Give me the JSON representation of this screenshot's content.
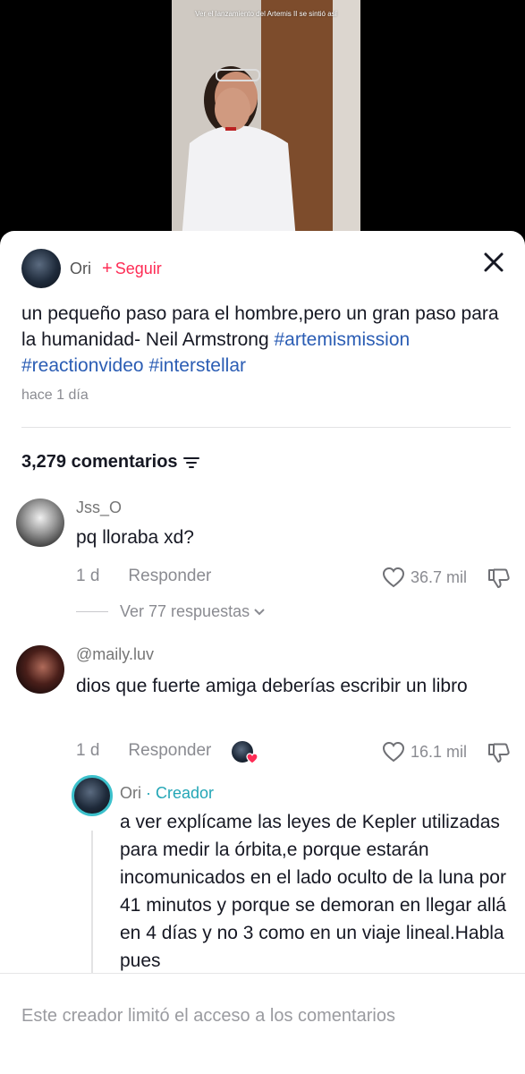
{
  "video": {
    "overlay_text": "Ver el lanzamiento del Artemis II se sintió así"
  },
  "post": {
    "author": "Ori",
    "follow_label": "Seguir",
    "follow_plus": "+",
    "caption_text": "un pequeño paso para el hombre,pero un gran paso para la humanidad- Neil Armstrong ",
    "hashtags": [
      "#artemismission",
      "#reactionvideo",
      "#interstellar"
    ],
    "timestamp": "hace 1 día"
  },
  "comments_header": {
    "count_label": "3,279 comentarios"
  },
  "comments": [
    {
      "user": "Jss_O",
      "text": "pq lloraba xd?",
      "age": "1 d",
      "reply_label": "Responder",
      "likes": "36.7 mil",
      "view_replies": "Ver 77 respuestas"
    },
    {
      "user": "@maily.luv",
      "text": "dios que fuerte amiga deberías escribir un libro",
      "age": "1 d",
      "reply_label": "Responder",
      "likes": "16.1 mil"
    }
  ],
  "creator_reply": {
    "user": "Ori",
    "separator": " · ",
    "tag": "Creador",
    "text": "a ver explícame las leyes de Kepler utilizadas para medir la órbita,e porque estarán incomunicados en el lado oculto de la luna por 41 minutos y porque se demoran en llegar allá en 4 días y no 3 como en un viaje lineal.Habla pues"
  },
  "footer": {
    "notice": "Este creador limitó el acceso a los comentarios"
  },
  "colors": {
    "accent": "#fe2c55",
    "hashtag": "#2b5db4",
    "creator": "#23a6b6"
  },
  "icons": {
    "close": "close-icon",
    "sort": "sort-icon",
    "like": "heart-outline-icon",
    "dislike": "dislike-icon",
    "chevron": "chevron-down-icon",
    "liked_by_creator": "creator-liked-icon"
  }
}
